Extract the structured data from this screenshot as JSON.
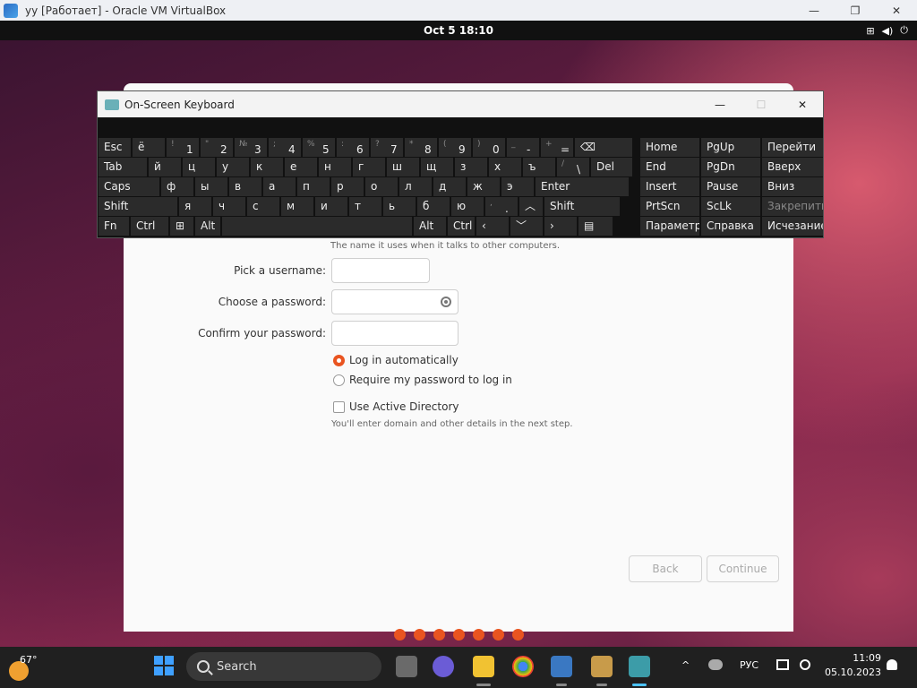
{
  "vbox": {
    "title": "yy [Работает] - Oracle VM VirtualBox",
    "min": "—",
    "max": "❐",
    "close": "✕"
  },
  "gnome": {
    "clock": "Oct 5  18:10",
    "tray_network": "⊞",
    "tray_volume": "◀)",
    "tray_power": "⏻"
  },
  "installer": {
    "hostname_hint": "The name it uses when it talks to other computers.",
    "username_label": "Pick a username:",
    "username_value": "",
    "password_label": "Choose a password:",
    "password_value": "",
    "confirm_label": "Confirm your password:",
    "confirm_value": "",
    "login_auto": "Log in automatically",
    "login_password": "Require my password to log in",
    "active_directory": "Use Active Directory",
    "ad_hint": "You'll enter domain and other details in the next step.",
    "back": "Back",
    "continue": "Continue",
    "steps_count": 7
  },
  "osk": {
    "title": "On-Screen Keyboard",
    "min": "—",
    "max": "☐",
    "close": "✕",
    "row1": [
      {
        "t": "Esc"
      },
      {
        "t": "ё"
      },
      {
        "s": "!",
        "t": "1"
      },
      {
        "s": "\"",
        "t": "2"
      },
      {
        "s": "№",
        "t": "3"
      },
      {
        "s": ";",
        "t": "4"
      },
      {
        "s": "%",
        "t": "5"
      },
      {
        "s": ":",
        "t": "6"
      },
      {
        "s": "?",
        "t": "7"
      },
      {
        "s": "*",
        "t": "8"
      },
      {
        "s": "(",
        "t": "9"
      },
      {
        "s": ")",
        "t": "0"
      },
      {
        "s": "_",
        "t": "-"
      },
      {
        "s": "+",
        "t": "="
      },
      {
        "t": "⌫"
      }
    ],
    "row2": [
      {
        "t": "Tab"
      },
      {
        "t": "й"
      },
      {
        "t": "ц"
      },
      {
        "t": "у"
      },
      {
        "t": "к"
      },
      {
        "t": "е"
      },
      {
        "t": "н"
      },
      {
        "t": "г"
      },
      {
        "t": "ш"
      },
      {
        "t": "щ"
      },
      {
        "t": "з"
      },
      {
        "t": "х"
      },
      {
        "t": "ъ"
      },
      {
        "s": "/",
        "t": "\\"
      },
      {
        "t": "Del"
      }
    ],
    "row3": [
      {
        "t": "Caps"
      },
      {
        "t": "ф"
      },
      {
        "t": "ы"
      },
      {
        "t": "в"
      },
      {
        "t": "а"
      },
      {
        "t": "п"
      },
      {
        "t": "р"
      },
      {
        "t": "о"
      },
      {
        "t": "л"
      },
      {
        "t": "д"
      },
      {
        "t": "ж"
      },
      {
        "t": "э"
      },
      {
        "t": "Enter"
      }
    ],
    "row4": [
      {
        "t": "Shift"
      },
      {
        "t": "я"
      },
      {
        "t": "ч"
      },
      {
        "t": "с"
      },
      {
        "t": "м"
      },
      {
        "t": "и"
      },
      {
        "t": "т"
      },
      {
        "t": "ь"
      },
      {
        "t": "б"
      },
      {
        "t": "ю"
      },
      {
        "s": ",",
        "t": "."
      },
      {
        "t": "︿"
      },
      {
        "t": "Shift"
      }
    ],
    "row5": [
      {
        "t": "Fn"
      },
      {
        "t": "Ctrl"
      },
      {
        "t": "⊞"
      },
      {
        "t": "Alt"
      },
      {
        "t": ""
      },
      {
        "t": "Alt"
      },
      {
        "t": "Ctrl"
      },
      {
        "t": "‹"
      },
      {
        "t": "﹀"
      },
      {
        "t": "›"
      },
      {
        "t": "▤"
      }
    ],
    "nav": [
      [
        "Home",
        "PgUp",
        "Перейти"
      ],
      [
        "End",
        "PgDn",
        "Вверх"
      ],
      [
        "Insert",
        "Pause",
        "Вниз"
      ],
      [
        "PrtScn",
        "ScLk",
        "Закрепить"
      ],
      [
        "Параметры",
        "Справка",
        "Исчезание"
      ]
    ]
  },
  "taskbar": {
    "temperature": "67°",
    "search_label": "Search",
    "lang": "РУС",
    "chevron": "^",
    "time": "11:09",
    "date": "05.10.2023"
  },
  "colors": {
    "accent": "#e95420",
    "osk_key": "#2b2b2b",
    "taskbar": "#202020"
  }
}
